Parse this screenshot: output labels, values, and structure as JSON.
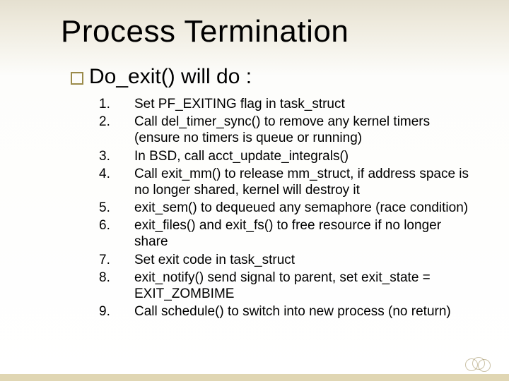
{
  "title": "Process Termination",
  "subhead": "Do_exit() will do :",
  "steps": [
    "Set PF_EXITING flag in task_struct",
    "Call del_timer_sync() to remove any kernel timers (ensure no timers is queue or running)",
    "In BSD, call acct_update_integrals()",
    "Call exit_mm() to release mm_struct, if address space is no longer shared, kernel will destroy it",
    " exit_sem() to dequeued any semaphore (race condition)",
    "exit_files() and exit_fs() to free resource if no longer share",
    "Set exit code in task_struct",
    "exit_notify() send signal to parent, set exit_state = EXIT_ZOMBIME",
    "Call  schedule() to switch into new process (no return)"
  ]
}
